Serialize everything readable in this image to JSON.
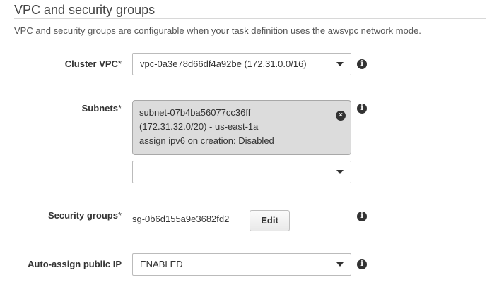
{
  "section": {
    "title": "VPC and security groups",
    "description": "VPC and security groups are configurable when your task definition uses the awsvpc network mode."
  },
  "cluster_vpc": {
    "label": "Cluster VPC",
    "required_mark": "*",
    "value": "vpc-0a3e78d66df4a92be (172.31.0.0/16)"
  },
  "subnets": {
    "label": "Subnets",
    "required_mark": "*",
    "selected": {
      "line1": "subnet-07b4ba56077cc36ff",
      "line2": "(172.31.32.0/20) - us-east-1a",
      "line3": "assign ipv6 on creation: Disabled"
    },
    "dropdown_value": ""
  },
  "security_groups": {
    "label": "Security groups",
    "required_mark": "*",
    "value": "sg-0b6d155a9e3682fd2",
    "edit_label": "Edit"
  },
  "auto_assign_ip": {
    "label": "Auto-assign public IP",
    "value": "ENABLED"
  },
  "icons": {
    "info": "i",
    "remove": "×"
  }
}
